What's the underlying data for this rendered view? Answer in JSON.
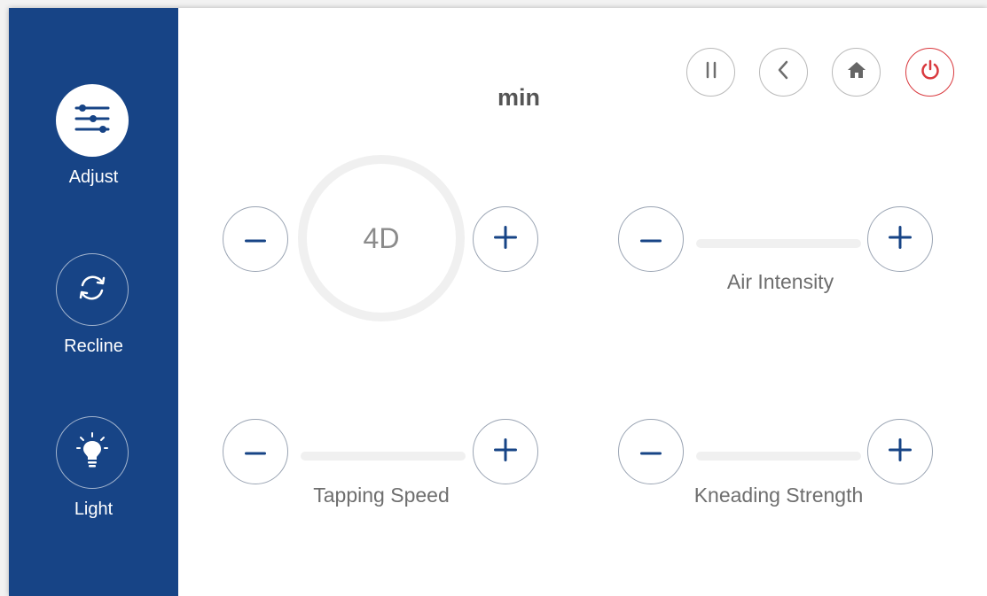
{
  "sidebar": {
    "items": [
      {
        "label": "Adjust",
        "icon": "sliders-icon",
        "active": true
      },
      {
        "label": "Recline",
        "icon": "sync-arrows-icon",
        "active": false
      },
      {
        "label": "Light",
        "icon": "lightbulb-icon",
        "active": false
      }
    ]
  },
  "header": {
    "buttons": [
      {
        "name": "pause",
        "icon": "pause-icon"
      },
      {
        "name": "back",
        "icon": "chevron-left-icon"
      },
      {
        "name": "home",
        "icon": "home-icon"
      },
      {
        "name": "power",
        "icon": "power-icon"
      }
    ]
  },
  "timer": {
    "unit_label": "min"
  },
  "controls": {
    "mode": {
      "value": "4D"
    },
    "air_intensity": {
      "label": "Air Intensity"
    },
    "tapping_speed": {
      "label": "Tapping Speed"
    },
    "kneading_strength": {
      "label": "Kneading Strength"
    }
  },
  "colors": {
    "sidebar_bg": "#174486",
    "accent_blue": "#174486",
    "power_red": "#d9393e",
    "track": "#f0f0f0"
  }
}
